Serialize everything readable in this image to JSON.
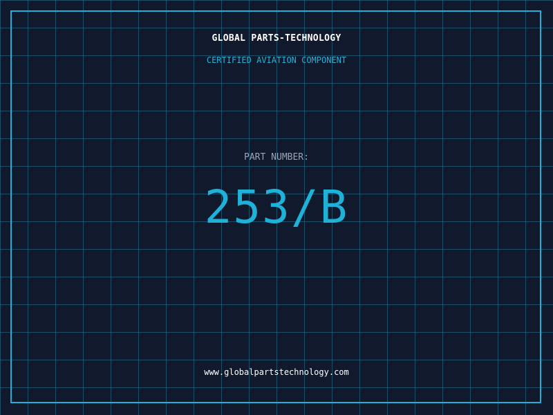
{
  "header": {
    "company_name": "GLOBAL PARTS-TECHNOLOGY",
    "tagline": "CERTIFIED AVIATION COMPONENT"
  },
  "part": {
    "label": "PART NUMBER:",
    "number": "253/B"
  },
  "footer": {
    "website": "www.globalpartstechnology.com"
  },
  "colors": {
    "background": "#101a2c",
    "grid": "#287896",
    "accent": "#1fb1d6",
    "label": "#9aa6b6",
    "text": "#ffffff"
  }
}
